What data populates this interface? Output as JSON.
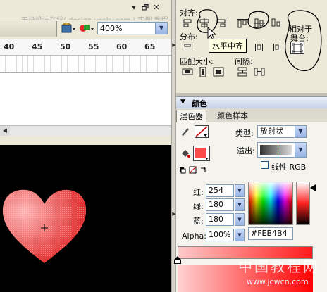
{
  "watermark_top": "天极设计在线( design.yesky.com ) 实例  教程",
  "watermark_bottom": "中国教程网",
  "watermark_url": "www.jcwcn.com",
  "window_controls": [
    "▾",
    "🗗",
    "✕"
  ],
  "toolbar": {
    "zoom_value": "400%"
  },
  "ruler": {
    "numbers": [
      "40",
      "45",
      "50",
      "55",
      "60",
      "65"
    ]
  },
  "align_panel": {
    "align_label": "对齐:",
    "distribute_label": "分布:",
    "match_size_label": "匹配大小:",
    "spacing_label": "间隔:",
    "relative_label_line1": "相对于",
    "relative_label_line2": "舞台:",
    "tooltip": "水平中齐"
  },
  "color_panel": {
    "title": "颜色",
    "tabs": [
      "混色器",
      "颜色样本"
    ],
    "type_label": "类型:",
    "type_value": "放射状",
    "overflow_label": "溢出:",
    "linear_rgb_label": "线性 RGB",
    "linear_rgb_checked": false,
    "red_label": "红:",
    "red_value": "254",
    "green_label": "绿:",
    "green_value": "180",
    "blue_label": "蓝:",
    "blue_value": "180",
    "alpha_label": "Alpha:",
    "alpha_value": "100%",
    "hex_value": "#FEB4B4",
    "fill_color": "#ff4040",
    "stroke_color": "#cc0000"
  },
  "colors": {
    "heart": "#e03030",
    "heart_highlight": "#ffb4b4",
    "stage": "#000000",
    "panel_bg": "#ece9d8"
  }
}
